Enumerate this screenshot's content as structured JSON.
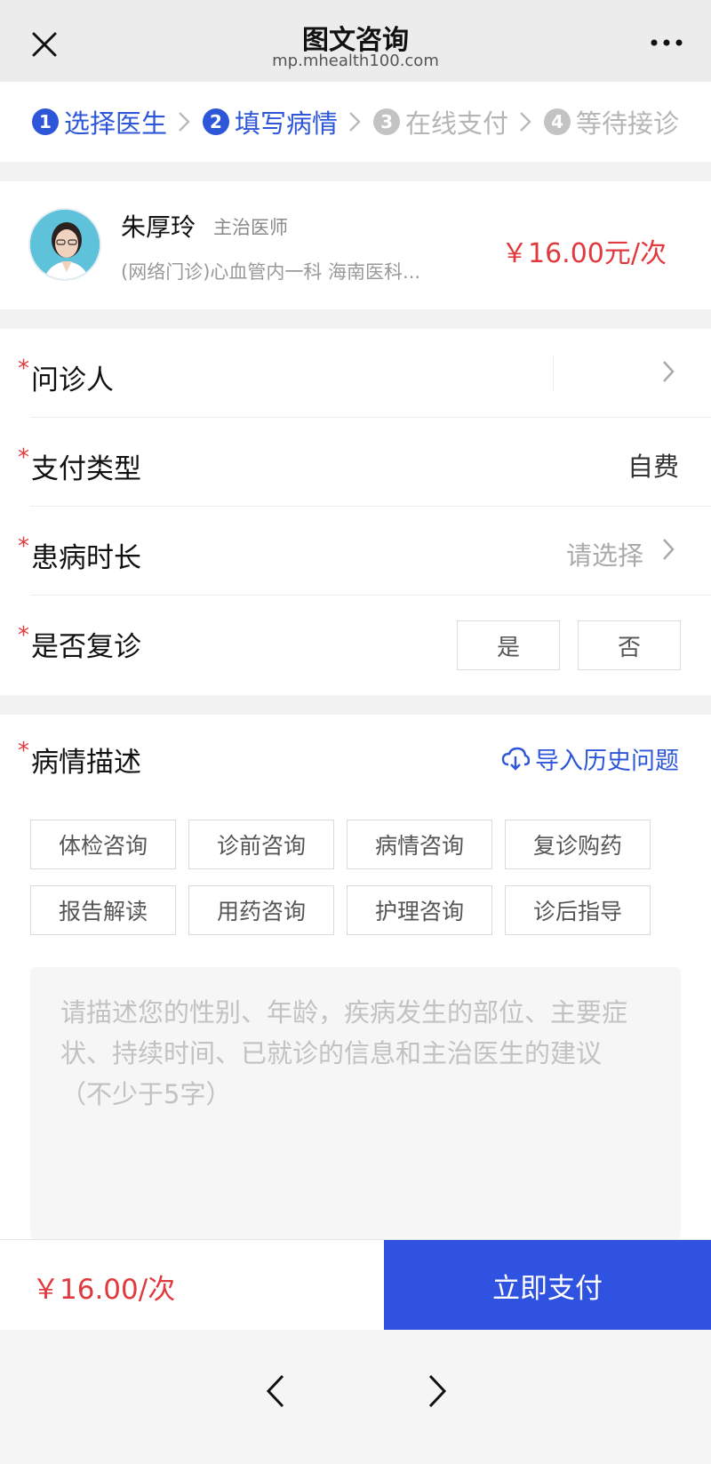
{
  "topbar": {
    "title": "图文咨询",
    "url": "mp.mhealth100.com"
  },
  "steps": [
    {
      "num": "1",
      "label": "选择医生",
      "state": "active"
    },
    {
      "num": "2",
      "label": "填写病情",
      "state": "active"
    },
    {
      "num": "3",
      "label": "在线支付",
      "state": "inactive"
    },
    {
      "num": "4",
      "label": "等待接诊",
      "state": "inactive"
    }
  ],
  "doctor": {
    "name": "朱厚玲",
    "title": "主治医师",
    "dept": "(网络门诊)心血管内一科   海南医科...",
    "price": "￥16.00元/次"
  },
  "form": {
    "required_mark": "*",
    "patient_label": "问诊人",
    "pay_type_label": "支付类型",
    "pay_type_value": "自费",
    "duration_label": "患病时长",
    "duration_placeholder": "请选择",
    "revisit_label": "是否复诊",
    "revisit_yes": "是",
    "revisit_no": "否"
  },
  "description": {
    "label": "病情描述",
    "import_label": "导入历史问题",
    "tags": [
      "体检咨询",
      "诊前咨询",
      "病情咨询",
      "复诊购药",
      "报告解读",
      "用药咨询",
      "护理咨询",
      "诊后指导"
    ],
    "placeholder": "请描述您的性别、年龄，疾病发生的部位、主要症状、持续时间、已就诊的信息和主治医生的建议（不少于5字）"
  },
  "paybar": {
    "price": "￥16.00/次",
    "pay_label": "立即支付"
  },
  "colors": {
    "accent": "#2d56d8",
    "price": "#e0393e",
    "pay_button": "#2f52e0"
  }
}
